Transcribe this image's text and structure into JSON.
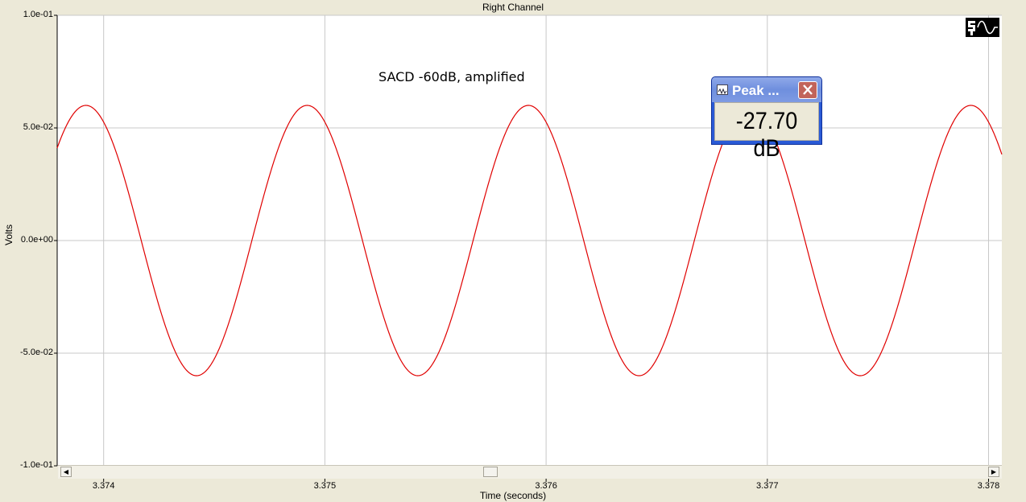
{
  "window": {
    "title": "Right Channel"
  },
  "annotation": "SACD -60dB, amplified",
  "peak_window": {
    "title": "Peak ...",
    "value": "-27.70 dB"
  },
  "colors": {
    "trace": "#e00000",
    "grid": "#c8c8c8",
    "plot_background": "#ffffff",
    "window_background": "#ece9d8",
    "peak_titlebar": "#7e9be3",
    "peak_close": "#c2645a"
  },
  "icons": {
    "scope_mode": "sine-wave-mode-icon",
    "peak_window_sys": "waveform-icon",
    "peak_close": "close-icon",
    "scroll_left": "scroll-left-arrow-icon",
    "scroll_right": "scroll-right-arrow-icon"
  },
  "scrollbar": {
    "left_arrow": "◀",
    "right_arrow": "▶"
  },
  "chart_data": {
    "type": "line",
    "title": "Right Channel",
    "xlabel": "Time (seconds)",
    "ylabel": "Volts",
    "xlim": [
      3.37379,
      3.37806
    ],
    "ylim": [
      -0.1,
      0.1
    ],
    "grid": true,
    "x_ticks": [
      3.374,
      3.375,
      3.376,
      3.377,
      3.378
    ],
    "x_tick_labels": [
      "3.374",
      "3.375",
      "3.376",
      "3.377",
      "3.378"
    ],
    "y_ticks": [
      0.1,
      0.05,
      0.0,
      -0.05,
      -0.1
    ],
    "y_tick_labels": [
      "1.0e-01",
      "5.0e-02",
      "0.0e+00",
      "-5.0e-02",
      "-1.0e-01"
    ],
    "series": [
      {
        "frequency_hz": 1000,
        "amplitude_volts": 0.06,
        "peak_time_seconds": 3.37392,
        "x": [
          3.37379,
          3.37384,
          3.37392,
          3.37404,
          3.37417,
          3.37429,
          3.37442,
          3.37454,
          3.37467,
          3.37479,
          3.37492,
          3.37504,
          3.37517,
          3.37529,
          3.37542,
          3.37554,
          3.37567,
          3.37579,
          3.37592,
          3.37604,
          3.37617,
          3.37629,
          3.37642,
          3.37654,
          3.37667,
          3.37679,
          3.37692,
          3.37704,
          3.37717,
          3.37729,
          3.37742,
          3.37754,
          3.37767,
          3.37779,
          3.37792,
          3.37806
        ],
        "y": [
          0.04,
          0.052,
          0.06,
          0.055,
          0.042,
          0.0,
          -0.042,
          -0.06,
          -0.042,
          0.0,
          0.042,
          0.06,
          0.042,
          0.0,
          -0.042,
          -0.06,
          -0.042,
          0.0,
          0.042,
          0.06,
          0.042,
          0.0,
          -0.042,
          -0.06,
          -0.042,
          0.0,
          0.042,
          0.06,
          0.042,
          0.0,
          -0.042,
          -0.06,
          -0.042,
          0.0,
          0.042,
          0.05
        ]
      }
    ]
  }
}
